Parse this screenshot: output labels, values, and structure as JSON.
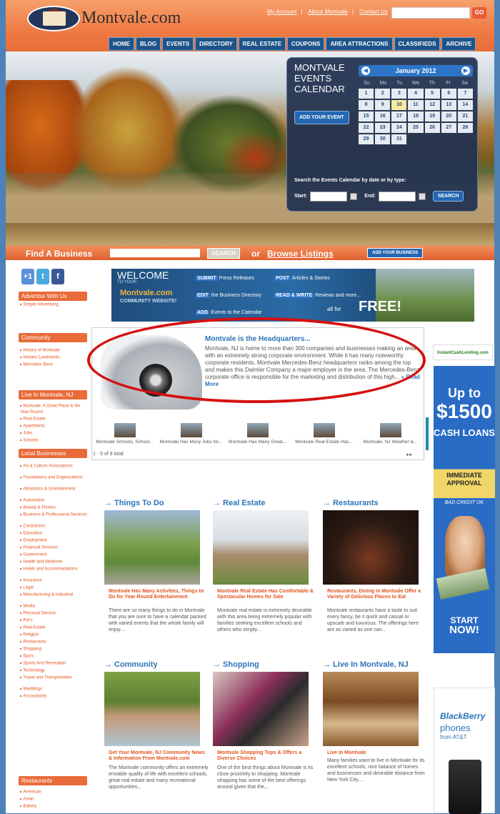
{
  "header": {
    "logo_text": "Montvale.com",
    "top_links": [
      "My Account",
      "About Montvale",
      "Contact Us"
    ],
    "search_placeholder": "",
    "go_label": "GO",
    "nav": [
      "HOME",
      "BLOG",
      "EVENTS",
      "DIRECTORY",
      "REAL ESTATE",
      "COUPONS",
      "AREA ATTRACTIONS",
      "CLASSIFIEDS",
      "ARCHIVE"
    ]
  },
  "events_calendar": {
    "title": "MONTVALE EVENTS CALENDAR",
    "add_event": "ADD YOUR EVENT",
    "month": "January 2012",
    "dow": [
      "Su",
      "Mo",
      "Tu",
      "We",
      "Th",
      "Fr",
      "Sa"
    ],
    "days": [
      "1",
      "2",
      "3",
      "4",
      "5",
      "6",
      "7",
      "8",
      "9",
      "10",
      "11",
      "12",
      "13",
      "14",
      "15",
      "16",
      "17",
      "18",
      "19",
      "20",
      "21",
      "22",
      "23",
      "24",
      "25",
      "26",
      "27",
      "28",
      "29",
      "30",
      "31"
    ],
    "today": "10",
    "search_text": "Search the Events Calendar by date or by type:",
    "start_label": "Start:",
    "end_label": "End:",
    "search_button": "SEARCH"
  },
  "find_business": {
    "label": "Find A Business",
    "search_button": "SEARCH",
    "or_text": "or",
    "browse_link": "Browse Listings",
    "add_button": "ADD YOUR BUSINESS"
  },
  "sidebar": {
    "social": [
      "+1",
      "t",
      "f"
    ],
    "advertise": {
      "title": "Advertise With Us",
      "items": [
        "Simple Advertising"
      ]
    },
    "community": {
      "title": "Community",
      "items": [
        "History of Montvale",
        "Historic Landmarks",
        "Mercedes Benz"
      ]
    },
    "live": {
      "title": "Live In Montvale, NJ",
      "items": [
        "Montvale: A Great Place to Be Year-Round",
        "Real Estate",
        "Apartments",
        "Jobs",
        "Schools"
      ]
    },
    "local": {
      "title": "Local Businesses",
      "items": [
        "Art & Culture Associations",
        "Foundations and Organizations",
        "Attractions & Entertainment",
        "Automotive",
        "Beauty & Fitness",
        "Business & Professional Services",
        "Contractors",
        "Education",
        "Employment",
        "Financial Services",
        "Government",
        "Health and Medicine",
        "Hotels and Accommodations",
        "Insurance",
        "Legal",
        "Manufacturing & Industrial",
        "Media",
        "Personal Service",
        "Pet's",
        "Real Estate",
        "Religion",
        "Restaurants",
        "Shopping",
        "Spa's",
        "Sports And Recreation",
        "Technology",
        "Travel and Transportation",
        "Weddings",
        "Accountants"
      ]
    },
    "restaurants": {
      "title": "Restaurants",
      "items": [
        "American",
        "Asian",
        "Bakery"
      ]
    }
  },
  "welcome": {
    "line1": "WELCOME",
    "line2": "TO YOUR",
    "brand": "Montvale.com",
    "sub": "COMMUNITY WEBSITE!",
    "links": [
      {
        "tag": "SUBMIT",
        "text": "Press Releases"
      },
      {
        "tag": "POST",
        "text": "Articles & Stories"
      },
      {
        "tag": "EDIT",
        "text": "the Business Directory"
      },
      {
        "tag": "READ & WRITE",
        "text": "Reviews and more..."
      },
      {
        "tag": "ADD",
        "text": "Events to the Calendar"
      }
    ],
    "all_for": "all for",
    "free": "FREE!"
  },
  "featured": {
    "title": "Montvale is the Headquarters...",
    "desc": "Montvale, NJ is home to more than 300 companies and businesses making an area with an extremely strong corporate environment. While it has many noteworthy corporate residents, Montvale Mercedes-Benz headquarters ranks among the top and makes this Daimler Company a major employer in the area. The Mercedes-Benz corporate office is responsible for the marketing and distribution of this high...",
    "read_more": "» Read More",
    "thumbs": [
      "Montvale Schools, School...",
      "Montvale Has Many Jobs for...",
      "Montvale Has Many Great...",
      "Montvale Real Estate Has...",
      "Montvale, NJ Weather &..."
    ],
    "count": "1 - 5 of 8 total"
  },
  "categories": [
    {
      "heading": "→ Things To Do",
      "title": "Montvale Has Many Activities, Things to Do for Year-Round Entertainment",
      "desc": "There are so many things to do in Montvale that you are sure to have a calendar packed with varied events that the whole family will enjoy...."
    },
    {
      "heading": "→ Real Estate",
      "title": "Montvale Real Estate Has Comfortable & Spectacular Homes for Sale",
      "desc": "Montvale real estate is extremely desirable with this area being extremely popular with families seeking excellent schools and others who simply..."
    },
    {
      "heading": "→ Restaurants",
      "title": "Restaurants, Dining in Montvale Offer a Variety of Delicious Places to Eat",
      "desc": "Montvale restaurants have a taste to suit every fancy, be it quick and casual or upscale and luxurious. The offerings here are as varied as one can..."
    },
    {
      "heading": "→ Community",
      "title": "Get Your Montvale, NJ Community News & Information From Montvale.com",
      "desc": "The Montvale community offers an extremely enviable quality of life with excellent schools, great real estate and many recreational opportunities..."
    },
    {
      "heading": "→ Shopping",
      "title": "Montvale Shopping Tops & Offers a Diverse Choices",
      "desc": "One of the best things about Montvale is its close proximity to shopping. Montvale shopping has some of the best offerings around given that the..."
    },
    {
      "heading": "→ Live In Montvale, NJ",
      "title": "Live In Montvale",
      "desc": "Many families want to live in Montvale for its excellent schools, nice balance of homes and businesses and desirable distance from New York City...."
    }
  ],
  "ads": {
    "top": "InstantCashLending.com",
    "loan": {
      "upto": "Up to",
      "amount": "$1500",
      "cash": "CASH LOANS",
      "immediate": "IMMEDIATE APPROVAL",
      "bad_credit": "BAD CREDIT OK",
      "start": "START",
      "now": "NOW!"
    },
    "blackberry": {
      "brand": "BlackBerry",
      "phones": "phones",
      "att": "from AT&T"
    }
  }
}
